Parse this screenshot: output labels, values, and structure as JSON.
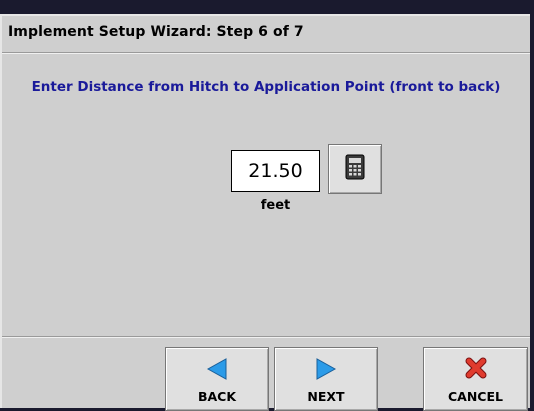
{
  "window": {
    "title": "Implement Setup Wizard:  Step 6 of 7"
  },
  "main": {
    "prompt": "Enter Distance from Hitch to Application Point (front to back)",
    "value": "21.50",
    "unit": "feet",
    "calculator_icon": "calculator-icon"
  },
  "footer": {
    "back_label": "BACK",
    "next_label": "NEXT",
    "cancel_label": "CANCEL",
    "back_icon": "triangle-left-icon",
    "next_icon": "triangle-right-icon",
    "cancel_icon": "x-icon"
  },
  "colors": {
    "panel": "#cfcfcf",
    "prompt_text": "#1a1a9a",
    "arrow_blue": "#2b9be8",
    "cancel_red": "#e03b2e"
  }
}
